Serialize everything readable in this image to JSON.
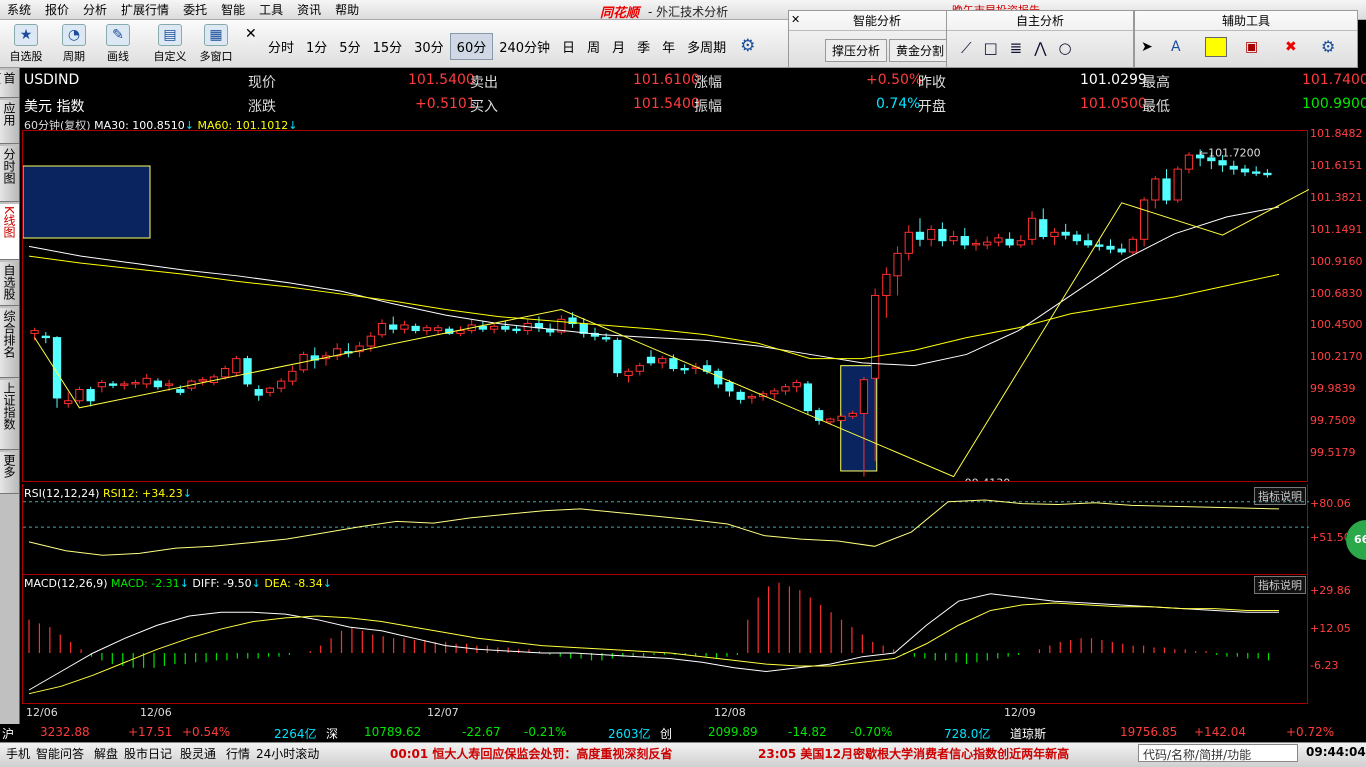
{
  "menu": [
    "系统",
    "报价",
    "分析",
    "扩展行情",
    "委托",
    "智能",
    "工具",
    "资讯",
    "帮助"
  ],
  "brand": "同花顺",
  "app_title": "- 外汇技术分析",
  "marquee": "晚午市早投资报告",
  "toolbar": {
    "buttons": [
      {
        "label": "自选股",
        "icon": "star-icon"
      },
      {
        "label": "周期",
        "icon": "clock-icon"
      },
      {
        "label": "画线",
        "icon": "pen-icon"
      },
      {
        "label": "自定义",
        "icon": "layout-icon"
      },
      {
        "label": "多窗口",
        "icon": "grid-icon"
      }
    ]
  },
  "periods": [
    "分时",
    "1分",
    "5分",
    "15分",
    "30分",
    "60分",
    "240分钟",
    "日",
    "周",
    "月",
    "季",
    "年",
    "多周期"
  ],
  "active_period": "60分",
  "panels": {
    "smart": {
      "title": "智能分析",
      "b1": "撑压分析",
      "b2": "黄金分割"
    },
    "self": {
      "title": "自主分析"
    },
    "aux": {
      "title": "辅助工具"
    }
  },
  "leftnav": [
    "首页",
    "应用",
    "分时图",
    "K线图",
    "自选股",
    "综合排名",
    "上证指数",
    "更多"
  ],
  "quote": {
    "code": "USDIND",
    "name": "美元 指数",
    "xianjia_l": "现价",
    "xianjia": "101.5400",
    "zhangdie_l": "涨跌",
    "zhangdie": "+0.5101",
    "maichu_l": "卖出",
    "maichu": "101.6100",
    "mairu_l": "买入",
    "mairu": "101.5400",
    "zhangfu_l": "涨幅",
    "zhangfu": "+0.50%",
    "zhenfu_l": "振幅",
    "zhenfu": "0.74%",
    "zuoshou_l": "昨收",
    "zuoshou": "101.0299",
    "kaipan_l": "开盘",
    "kaipan": "101.0500",
    "zuigao_l": "最高",
    "zuigao": "101.7400",
    "zuidi_l": "最低",
    "zuidi": "100.9900"
  },
  "ma_line": {
    "label": "60分钟(复权)",
    "ma30": "MA30: 100.8510",
    "ma60": "MA60: 101.1012"
  },
  "price_axis": [
    "101.8482",
    "101.6151",
    "101.3821",
    "101.1491",
    "100.9160",
    "100.6830",
    "100.4500",
    "100.2170",
    "99.9839",
    "99.7509",
    "99.5179"
  ],
  "hi_mark": "101.7200",
  "lo_mark": "99.4130",
  "rsi": {
    "label": "RSI(12,12,24)",
    "rsi12": "RSI12: +34.23",
    "axis": [
      "+80.06",
      "+51.50"
    ],
    "tag": "指标说明"
  },
  "macd": {
    "label": "MACD(12,26,9)",
    "macd": "MACD: -2.31",
    "diff": "DIFF: -9.50",
    "dea": "DEA: -8.34",
    "axis": [
      "+29.86",
      "+12.05",
      "-6.23"
    ],
    "tag": "指标说明"
  },
  "x_labels": [
    "12/06",
    "12/06",
    "12/07",
    "12/08",
    "12/09"
  ],
  "badge": "66",
  "stats": {
    "hu": "沪",
    "hu_v": "3232.88",
    "hu_c": "+17.51",
    "hu_p": "+0.54%",
    "hu_a": "2264亿",
    "shen": "深",
    "shen_v": "10789.62",
    "shen_c": "-22.67",
    "shen_p": "-0.21%",
    "shen_a": "2603亿",
    "chuang": "创",
    "chuang_v": "2099.89",
    "chuang_c": "-14.82",
    "chuang_p": "-0.70%",
    "chuang_a": "728.0亿",
    "dow": "道琼斯",
    "dow_v": "19756.85",
    "dow_c": "+142.04",
    "dow_p": "+0.72%"
  },
  "footer": {
    "items": [
      "手机",
      "智能问答",
      "解盘",
      "股市日记",
      "股灵通",
      "行情",
      "24小时滚动"
    ],
    "news1": "00:01 恒大人寿回应保监会处罚：高度重视深刻反省",
    "news2": "23:05 美国12月密歇根大学消费者信心指数创近两年新高",
    "search": "代码/名称/简拼/功能",
    "clock": "09:44:04"
  },
  "chart_data": {
    "type": "candlestick",
    "price_range": [
      99.4,
      101.85
    ],
    "candles": [
      [
        100.43,
        100.47,
        100.38,
        100.45
      ],
      [
        100.41,
        100.44,
        100.36,
        100.4
      ],
      [
        100.4,
        100.41,
        99.9,
        99.97
      ],
      [
        99.93,
        100.01,
        99.9,
        99.95
      ],
      [
        99.95,
        100.05,
        99.93,
        100.03
      ],
      [
        100.03,
        100.05,
        99.91,
        99.95
      ],
      [
        100.05,
        100.1,
        100.01,
        100.08
      ],
      [
        100.07,
        100.09,
        100.04,
        100.06
      ],
      [
        100.06,
        100.09,
        100.03,
        100.07
      ],
      [
        100.07,
        100.1,
        100.04,
        100.08
      ],
      [
        100.07,
        100.14,
        100.04,
        100.11
      ],
      [
        100.09,
        100.11,
        100.03,
        100.05
      ],
      [
        100.06,
        100.1,
        100.02,
        100.07
      ],
      [
        100.03,
        100.06,
        99.99,
        100.01
      ],
      [
        100.04,
        100.1,
        100.02,
        100.09
      ],
      [
        100.09,
        100.12,
        100.06,
        100.1
      ],
      [
        100.08,
        100.14,
        100.06,
        100.12
      ],
      [
        100.12,
        100.2,
        100.1,
        100.18
      ],
      [
        100.15,
        100.27,
        100.12,
        100.25
      ],
      [
        100.25,
        100.27,
        100.05,
        100.07
      ],
      [
        100.03,
        100.06,
        99.95,
        99.99
      ],
      [
        100.01,
        100.05,
        99.98,
        100.04
      ],
      [
        100.04,
        100.11,
        100.01,
        100.09
      ],
      [
        100.09,
        100.2,
        100.06,
        100.16
      ],
      [
        100.17,
        100.3,
        100.15,
        100.28
      ],
      [
        100.27,
        100.33,
        100.18,
        100.24
      ],
      [
        100.25,
        100.3,
        100.2,
        100.27
      ],
      [
        100.27,
        100.36,
        100.24,
        100.32
      ],
      [
        100.3,
        100.36,
        100.26,
        100.29
      ],
      [
        100.3,
        100.37,
        100.26,
        100.34
      ],
      [
        100.34,
        100.44,
        100.3,
        100.41
      ],
      [
        100.42,
        100.53,
        100.4,
        100.5
      ],
      [
        100.49,
        100.55,
        100.43,
        100.46
      ],
      [
        100.46,
        100.52,
        100.43,
        100.49
      ],
      [
        100.48,
        100.5,
        100.43,
        100.45
      ],
      [
        100.45,
        100.49,
        100.42,
        100.47
      ],
      [
        100.45,
        100.49,
        100.42,
        100.47
      ],
      [
        100.46,
        100.48,
        100.42,
        100.43
      ],
      [
        100.43,
        100.48,
        100.41,
        100.45
      ],
      [
        100.45,
        100.53,
        100.43,
        100.49
      ],
      [
        100.48,
        100.52,
        100.44,
        100.46
      ],
      [
        100.46,
        100.5,
        100.43,
        100.48
      ],
      [
        100.48,
        100.52,
        100.44,
        100.46
      ],
      [
        100.46,
        100.49,
        100.43,
        100.45
      ],
      [
        100.45,
        100.53,
        100.42,
        100.5
      ],
      [
        100.5,
        100.55,
        100.44,
        100.47
      ],
      [
        100.46,
        100.5,
        100.41,
        100.44
      ],
      [
        100.44,
        100.56,
        100.42,
        100.53
      ],
      [
        100.54,
        100.58,
        100.47,
        100.5
      ],
      [
        100.5,
        100.54,
        100.4,
        100.43
      ],
      [
        100.43,
        100.47,
        100.38,
        100.41
      ],
      [
        100.4,
        100.43,
        100.37,
        100.39
      ],
      [
        100.38,
        100.4,
        100.12,
        100.15
      ],
      [
        100.13,
        100.18,
        100.08,
        100.16
      ],
      [
        100.16,
        100.22,
        100.13,
        100.2
      ],
      [
        100.26,
        100.31,
        100.2,
        100.22
      ],
      [
        100.22,
        100.27,
        100.18,
        100.25
      ],
      [
        100.25,
        100.28,
        100.16,
        100.18
      ],
      [
        100.18,
        100.21,
        100.14,
        100.17
      ],
      [
        100.18,
        100.22,
        100.14,
        100.19
      ],
      [
        100.2,
        100.24,
        100.14,
        100.16
      ],
      [
        100.16,
        100.18,
        100.04,
        100.07
      ],
      [
        100.08,
        100.1,
        99.98,
        100.02
      ],
      [
        100.01,
        100.03,
        99.93,
        99.96
      ],
      [
        99.97,
        100.0,
        99.93,
        99.98
      ],
      [
        99.98,
        100.02,
        99.95,
        100.0
      ],
      [
        100.0,
        100.04,
        99.96,
        100.02
      ],
      [
        100.02,
        100.07,
        99.99,
        100.05
      ],
      [
        100.05,
        100.1,
        100.01,
        100.08
      ],
      [
        100.07,
        100.09,
        99.85,
        99.88
      ],
      [
        99.88,
        99.9,
        99.78,
        99.81
      ],
      [
        99.8,
        99.83,
        99.78,
        99.82
      ],
      [
        99.81,
        99.86,
        99.79,
        99.84
      ],
      [
        99.84,
        99.88,
        99.82,
        99.86
      ],
      [
        99.86,
        100.12,
        99.41,
        100.1
      ],
      [
        100.11,
        100.75,
        99.52,
        100.7
      ],
      [
        100.7,
        100.9,
        100.54,
        100.85
      ],
      [
        100.84,
        101.05,
        100.7,
        101.0
      ],
      [
        101.0,
        101.2,
        100.95,
        101.15
      ],
      [
        101.15,
        101.25,
        101.05,
        101.1
      ],
      [
        101.1,
        101.2,
        101.05,
        101.17
      ],
      [
        101.17,
        101.22,
        101.05,
        101.09
      ],
      [
        101.09,
        101.16,
        101.06,
        101.12
      ],
      [
        101.12,
        101.18,
        101.03,
        101.06
      ],
      [
        101.06,
        101.1,
        101.02,
        101.07
      ],
      [
        101.06,
        101.12,
        101.03,
        101.08
      ],
      [
        101.08,
        101.14,
        101.05,
        101.11
      ],
      [
        101.1,
        101.15,
        101.04,
        101.06
      ],
      [
        101.06,
        101.13,
        101.04,
        101.09
      ],
      [
        101.1,
        101.3,
        101.06,
        101.25
      ],
      [
        101.24,
        101.32,
        101.1,
        101.12
      ],
      [
        101.12,
        101.18,
        101.06,
        101.15
      ],
      [
        101.15,
        101.21,
        101.1,
        101.13
      ],
      [
        101.13,
        101.16,
        101.06,
        101.09
      ],
      [
        101.09,
        101.14,
        101.04,
        101.06
      ],
      [
        101.06,
        101.1,
        101.02,
        101.05
      ],
      [
        101.05,
        101.1,
        101.0,
        101.03
      ],
      [
        101.03,
        101.07,
        100.99,
        101.01
      ],
      [
        101.01,
        101.12,
        100.99,
        101.1
      ],
      [
        101.1,
        101.4,
        101.05,
        101.38
      ],
      [
        101.38,
        101.55,
        101.32,
        101.53
      ],
      [
        101.53,
        101.6,
        101.35,
        101.38
      ],
      [
        101.38,
        101.62,
        101.36,
        101.6
      ],
      [
        101.6,
        101.72,
        101.57,
        101.7
      ],
      [
        101.7,
        101.74,
        101.62,
        101.68
      ],
      [
        101.68,
        101.72,
        101.6,
        101.66
      ],
      [
        101.66,
        101.7,
        101.58,
        101.63
      ],
      [
        101.62,
        101.66,
        101.56,
        101.6
      ],
      [
        101.6,
        101.63,
        101.55,
        101.58
      ],
      [
        101.58,
        101.62,
        101.55,
        101.57
      ],
      [
        101.57,
        101.6,
        101.54,
        101.56
      ]
    ],
    "ma30": [
      101.05,
      100.98,
      100.93,
      100.88,
      100.84,
      100.79,
      100.73,
      100.64,
      100.56,
      100.5,
      100.46,
      100.42,
      100.4,
      100.38,
      100.34,
      100.28,
      100.22,
      100.2,
      100.28,
      100.45,
      100.7,
      100.95,
      101.14,
      101.26,
      101.33
    ],
    "ma60": [
      100.98,
      100.93,
      100.89,
      100.85,
      100.8,
      100.76,
      100.71,
      100.66,
      100.6,
      100.55,
      100.52,
      100.49,
      100.46,
      100.42,
      100.36,
      100.25,
      100.25,
      100.31,
      100.4,
      100.47,
      100.57,
      100.63,
      100.69,
      100.77,
      100.85
    ],
    "zigzag": [
      [
        0,
        100.4
      ],
      [
        4,
        99.9
      ],
      [
        47,
        100.6
      ],
      [
        82,
        99.41
      ],
      [
        97,
        101.36
      ],
      [
        106,
        101.13
      ],
      [
        120,
        101.72
      ]
    ],
    "rsi12": [
      35,
      25,
      20,
      22,
      28,
      30,
      34,
      38,
      45,
      52,
      58,
      56,
      62,
      66,
      70,
      72,
      68,
      64,
      60,
      55,
      42,
      38,
      36,
      30,
      46,
      80,
      82,
      78,
      77,
      79,
      76,
      75,
      74,
      73,
      72
    ],
    "diff": [
      -20,
      -10,
      0,
      8,
      15,
      20,
      22,
      22,
      21,
      18,
      14,
      12,
      8,
      4,
      2,
      1,
      0,
      0,
      -1,
      -2,
      -3,
      -5,
      -8,
      -10,
      -8,
      -6,
      -2,
      0,
      15,
      28,
      32,
      30,
      28,
      27,
      26,
      25,
      24,
      23,
      22,
      22
    ],
    "dea": [
      -22,
      -18,
      -12,
      -5,
      2,
      8,
      13,
      17,
      19,
      20,
      19,
      17,
      14,
      11,
      8,
      6,
      4,
      3,
      2,
      1,
      0,
      -2,
      -4,
      -6,
      -7,
      -7,
      -5,
      -3,
      5,
      15,
      23,
      26,
      27,
      26,
      25,
      25,
      24,
      24,
      23,
      23
    ],
    "macd": [
      18,
      16,
      14,
      10,
      6,
      2,
      -2,
      -4,
      -6,
      -7,
      -8,
      -8,
      -8,
      -7,
      -6,
      -6,
      -5,
      -5,
      -4,
      -4,
      -3,
      -3,
      -3,
      -2,
      -2,
      -1,
      0,
      1,
      4,
      8,
      12,
      14,
      12,
      10,
      9,
      8,
      8,
      7,
      7,
      6,
      6,
      5,
      5,
      4,
      4,
      3,
      3,
      2,
      2,
      1,
      -1,
      -2,
      -3,
      -3,
      -4,
      -4,
      -3,
      -2,
      -2,
      -2,
      -1,
      -1,
      -1,
      -1,
      -2,
      -2,
      -3,
      -2,
      -1,
      18,
      30,
      36,
      38,
      36,
      34,
      30,
      26,
      22,
      18,
      14,
      10,
      6,
      4,
      2,
      -1,
      -2,
      -3,
      -4,
      -4,
      -5,
      -6,
      -5,
      -4,
      -3,
      -2,
      -1,
      0,
      2,
      4,
      6,
      7,
      8,
      8,
      7,
      6,
      5,
      4,
      4,
      3,
      3,
      2,
      2,
      1,
      1,
      -1,
      -2,
      -2,
      -3,
      -3,
      -4
    ]
  }
}
